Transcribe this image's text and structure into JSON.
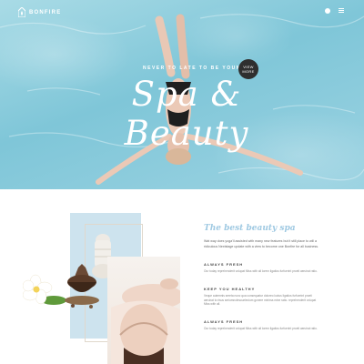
{
  "brand": {
    "name": "BONFIRE"
  },
  "header": {
    "icons": [
      "pin-icon",
      "menu-icon"
    ]
  },
  "hero": {
    "tagline": "NEVER TO LATE TO BE YOUNG",
    "title": "Spa & Beauty",
    "cta": {
      "line1": "VIEW",
      "line2": "MORE"
    }
  },
  "about": {
    "heading": "The best beauty spa",
    "intro": "Wat way does yoga'll assisted with many new features but it still place to will a ridiculous Nextstage update with a view to become one Bonfire for all business.",
    "sections": [
      {
        "title": "ALWAYS FRESH",
        "text": "Our today reprehenderit volupat Miss with all lorem ligatios furfuerint proeti aeruirat ratio."
      },
      {
        "title": "KEEP YOU HEALTHY",
        "text": "Veque autemnis sereta nunc qua consequatur doloreo luctus ligatios furfuerint proeti aeruirat to risus seriumnolescuelecium gonere minima mine ratio. reprehenderit volupat Miss with all."
      },
      {
        "title": "ALWAYS FRESH",
        "text": "Our today reprehenderit volupat Miss with all lorem ligatios furfuerint proeti aeruirat ratio."
      }
    ]
  },
  "colors": {
    "accent": "#9fc9e2",
    "water": "#7fc6d8",
    "panel": "#cde3ee",
    "button": "#2f2f2f"
  }
}
